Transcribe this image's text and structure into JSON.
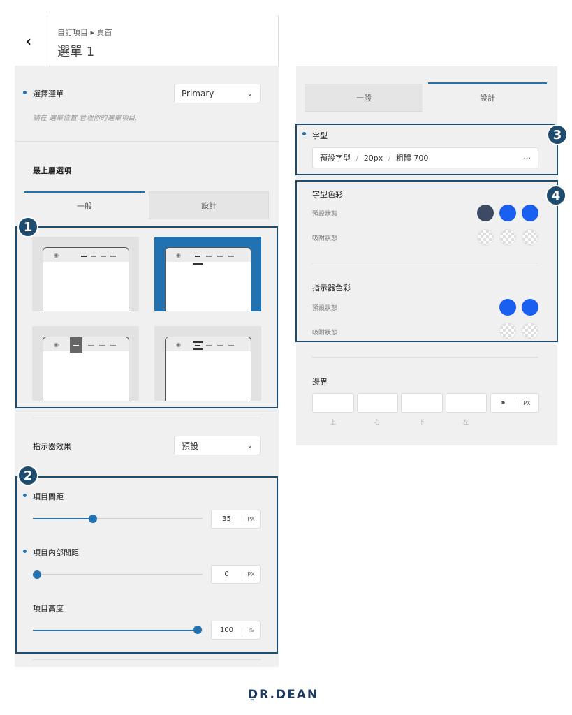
{
  "header": {
    "back_icon": "chevron-left-icon",
    "breadcrumb": "自訂項目 ▸ 頁首",
    "title": "選單 1"
  },
  "left": {
    "menu_select": {
      "label": "選擇選單",
      "value": "Primary",
      "hint": "請在 選單位置 管理你的選單項目."
    },
    "top_level_title": "最上層選項",
    "tabs": [
      {
        "label": "一般",
        "active": true
      },
      {
        "label": "設計",
        "active": false
      }
    ],
    "indicator": {
      "label": "指示器效果",
      "value": "預設"
    },
    "item_spacing": {
      "label": "項目間距",
      "value": "35",
      "unit": "PX",
      "fraction": 0.45
    },
    "item_padding": {
      "label": "項目內部間距",
      "value": "0",
      "unit": "PX",
      "fraction": 0.0
    },
    "item_height": {
      "label": "項目高度",
      "value": "100",
      "unit": "%",
      "fraction": 1.0
    }
  },
  "right": {
    "tabs": [
      {
        "label": "一般",
        "active": false
      },
      {
        "label": "設計",
        "active": true
      }
    ],
    "font": {
      "label": "字型",
      "family": "預設字型",
      "size": "20px",
      "weight": "粗體 700",
      "sep": "/",
      "more": "···"
    },
    "font_color": {
      "label": "字型色彩",
      "default_state": "預設狀態",
      "hover_state": "吸附狀態"
    },
    "indicator_color": {
      "label": "指示器色彩",
      "default_state": "預設狀態",
      "hover_state": "吸附狀態"
    },
    "border": {
      "label": "邊界",
      "sides": [
        "上",
        "右",
        "下",
        "左"
      ],
      "unit": "PX"
    }
  },
  "badges": [
    "1",
    "2",
    "3",
    "4"
  ],
  "colors": {
    "accent": "#2271b1",
    "dark_swatch": "#3c4a63",
    "blue_swatch": "#1a5ff0",
    "annotation": "#1e4c6e"
  },
  "logo": "R.DEAN"
}
